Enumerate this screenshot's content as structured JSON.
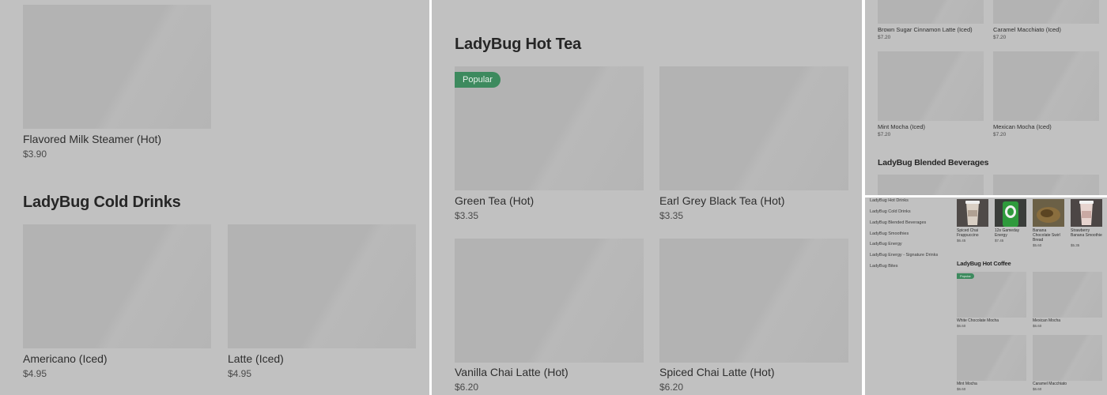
{
  "panel1": {
    "top_item": {
      "name": "Flavored Milk Steamer (Hot)",
      "price": "$3.90"
    },
    "section_title": "LadyBug Cold Drinks",
    "items": [
      {
        "name": "Americano (Iced)",
        "price": "$4.95"
      },
      {
        "name": "Latte (Iced)",
        "price": "$4.95"
      }
    ]
  },
  "panel2": {
    "section_title": "LadyBug Hot Tea",
    "badge": "Popular",
    "items": [
      {
        "name": "Green Tea (Hot)",
        "price": "$3.35"
      },
      {
        "name": "Earl Grey Black Tea (Hot)",
        "price": "$3.35"
      },
      {
        "name": "Vanilla Chai Latte (Hot)",
        "price": "$6.20"
      },
      {
        "name": "Spiced Chai Latte (Hot)",
        "price": "$6.20"
      }
    ]
  },
  "panel3": {
    "items": [
      {
        "name": "Brown Sugar Cinnamon Latte (Iced)",
        "price": "$7.20"
      },
      {
        "name": "Caramel Macchiato (Iced)",
        "price": "$7.20"
      },
      {
        "name": "Mint Mocha (Iced)",
        "price": "$7.20"
      },
      {
        "name": "Mexican Mocha (Iced)",
        "price": "$7.20"
      }
    ],
    "section_title": "LadyBug Blended Beverages"
  },
  "panel4": {
    "nav": [
      "LadyBug Hot Drinks",
      "LadyBug Cold Drinks",
      "LadyBug Blended Beverages",
      "LadyBug Smoothies",
      "LadyBug Energy",
      "LadyBug Energy - Signature Drinks",
      "LadyBug Bites"
    ],
    "top_items": [
      {
        "name": "Spiced Chai Frappuccino",
        "price": "$6.45"
      },
      {
        "name": "12s Gameday Energy",
        "price": "$7.45"
      },
      {
        "name": "Banana Chocolate Swirl Bread",
        "price": "$5.60"
      },
      {
        "name": "Strawberry Banana Smoothie",
        "price": "$5.35"
      }
    ],
    "section_title": "LadyBug Hot Coffee",
    "badge": "Popular",
    "items": [
      {
        "name": "White Chocolate Mocha",
        "price": "$6.60"
      },
      {
        "name": "Mexican Mocha",
        "price": "$6.60"
      },
      {
        "name": "Mint Mocha",
        "price": "$6.60"
      },
      {
        "name": "Caramel Macchiato",
        "price": "$6.60"
      }
    ]
  }
}
